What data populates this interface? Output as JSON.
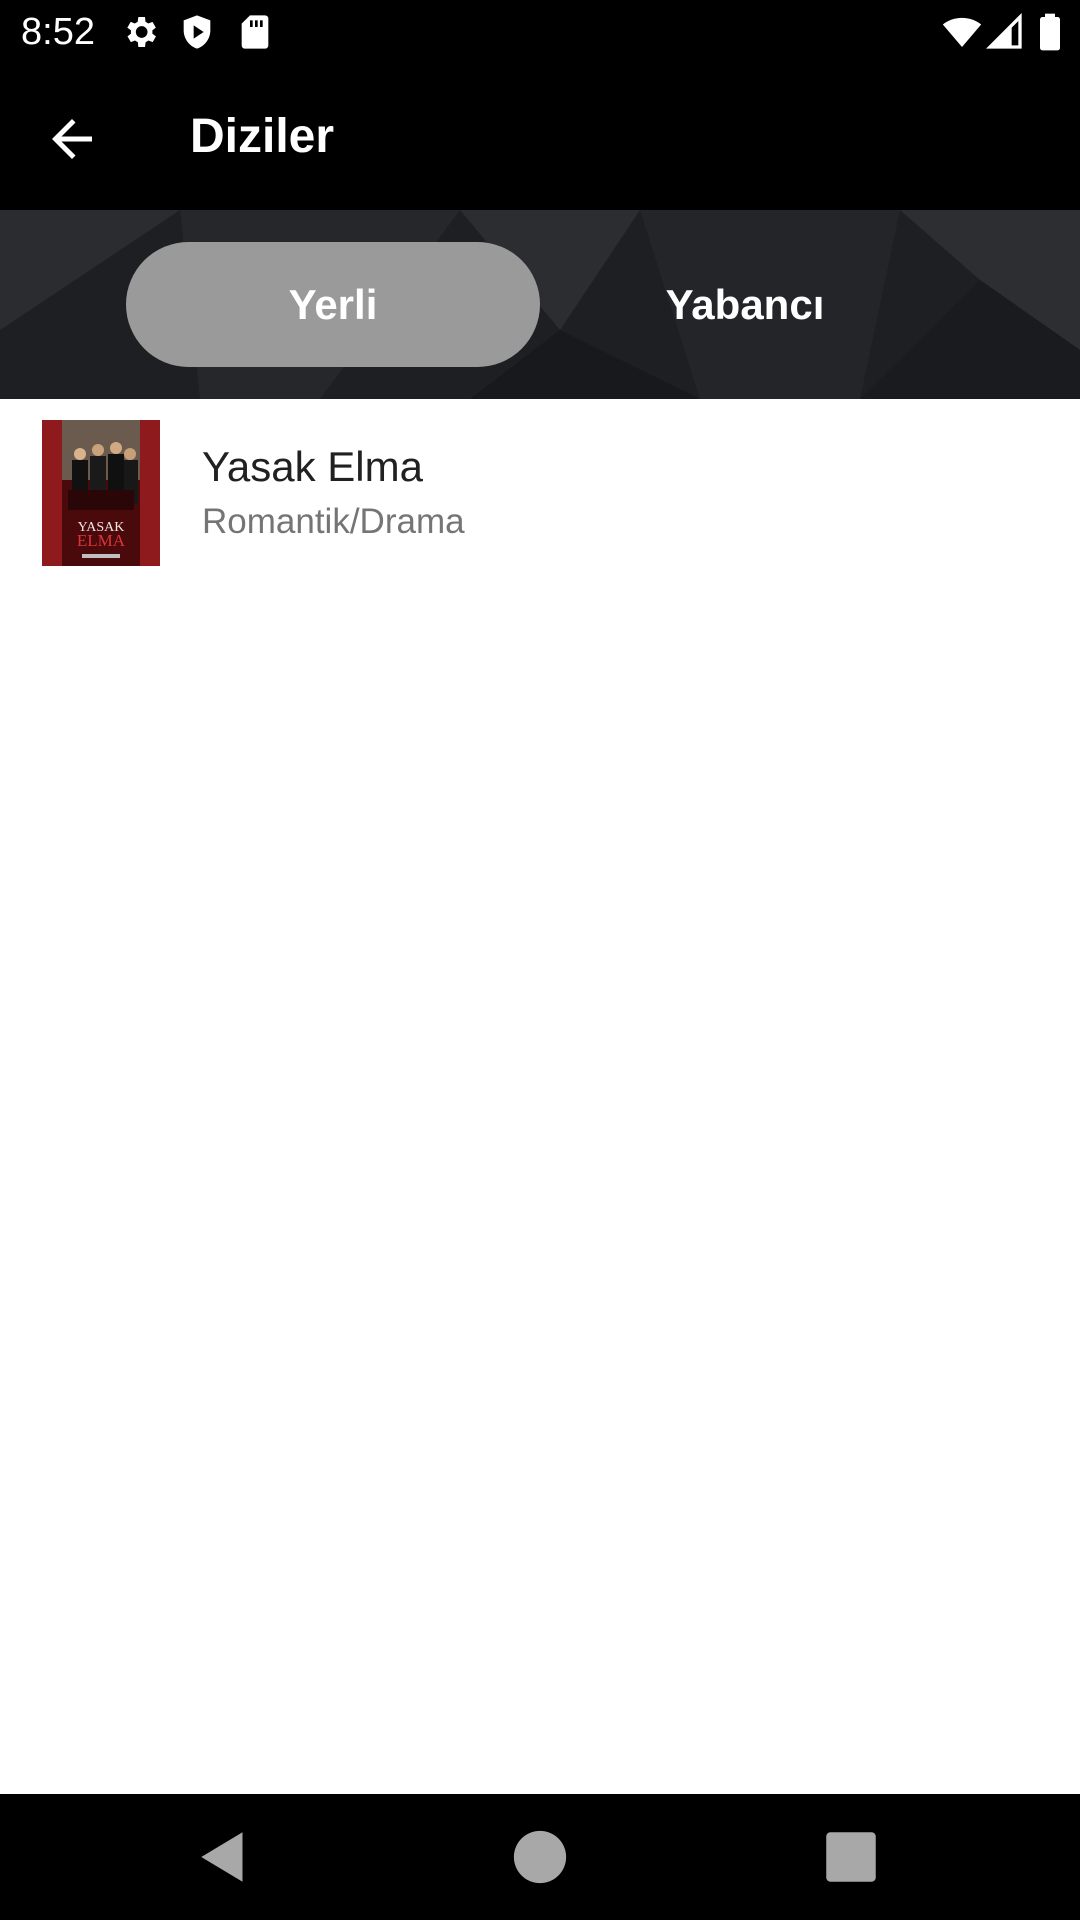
{
  "status_bar": {
    "time": "8:52",
    "left_icons": [
      "gear-icon",
      "shield-play-icon",
      "sd-card-icon"
    ],
    "right_icons": [
      "wifi-icon",
      "cell-signal-icon",
      "battery-icon"
    ]
  },
  "app_bar": {
    "title": "Diziler",
    "back_icon": "arrow-left-icon"
  },
  "tabs": [
    {
      "label": "Yerli",
      "selected": true
    },
    {
      "label": "Yabancı",
      "selected": false
    }
  ],
  "list": {
    "items": [
      {
        "title": "Yasak Elma",
        "genre": "Romantik/Drama",
        "poster_text": [
          "YASAK",
          "ELMA"
        ]
      }
    ]
  },
  "nav_bar": {
    "icons": [
      "back-triangle-icon",
      "home-circle-icon",
      "recents-square-icon"
    ]
  },
  "colors": {
    "status_bar_bg": "#000000",
    "app_bar_bg": "#000000",
    "tab_strip_bg": "#1e1f22",
    "tab_selected_bg": "#9a9a9b",
    "title_text": "#212121",
    "subtitle_text": "#757575"
  }
}
